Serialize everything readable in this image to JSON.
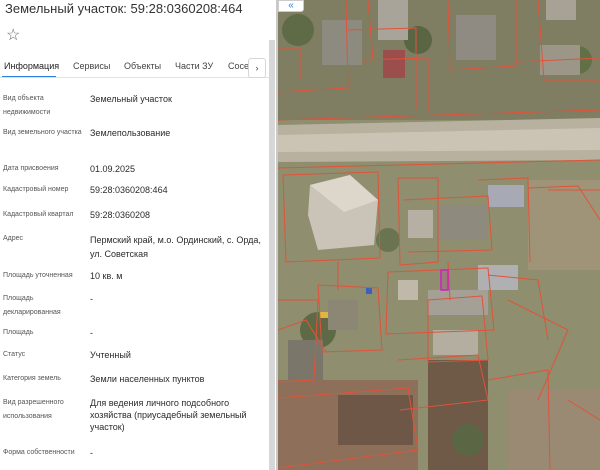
{
  "panel": {
    "title": "Земельный участок: 59:28:0360208:464",
    "star_icon": "☆",
    "tabs": [
      {
        "label": "Информация",
        "active": true
      },
      {
        "label": "Сервисы",
        "active": false
      },
      {
        "label": "Объекты",
        "active": false
      },
      {
        "label": "Части ЗУ",
        "active": false
      },
      {
        "label": "Сосе",
        "active": false
      }
    ],
    "tab_next": "›",
    "rows": [
      {
        "label": "Вид объекта недвижимости",
        "value": "Земельный участок"
      },
      {
        "label": "Вид земельного участка",
        "value": "Землепользование"
      },
      {
        "label": "Дата присвоения",
        "value": "01.09.2025"
      },
      {
        "label": "Кадастровый номер",
        "value": "59:28:0360208:464"
      },
      {
        "label": "Кадастровый квартал",
        "value": "59:28:0360208"
      },
      {
        "label": "Адрес",
        "value": "Пермский край, м.о. Ординский, с. Орда, ул. Советская"
      },
      {
        "label": "Площадь уточненная",
        "value": "10 кв. м"
      },
      {
        "label": "Площадь декларированная",
        "value": "-"
      },
      {
        "label": "Площадь",
        "value": "-"
      },
      {
        "label": "Статус",
        "value": "Учтенный"
      },
      {
        "label": "Категория земель",
        "value": "Земли населенных пунктов"
      },
      {
        "label": "Вид разрешенного использования",
        "value": "Для ведения личного подсобного хозяйства (приусадебный земельный участок)"
      },
      {
        "label": "Форма собственности",
        "value": "-"
      }
    ]
  },
  "map": {
    "collapse_icon": "«",
    "parcel_color": "#e0533a",
    "selected_color": "#d020c0"
  }
}
